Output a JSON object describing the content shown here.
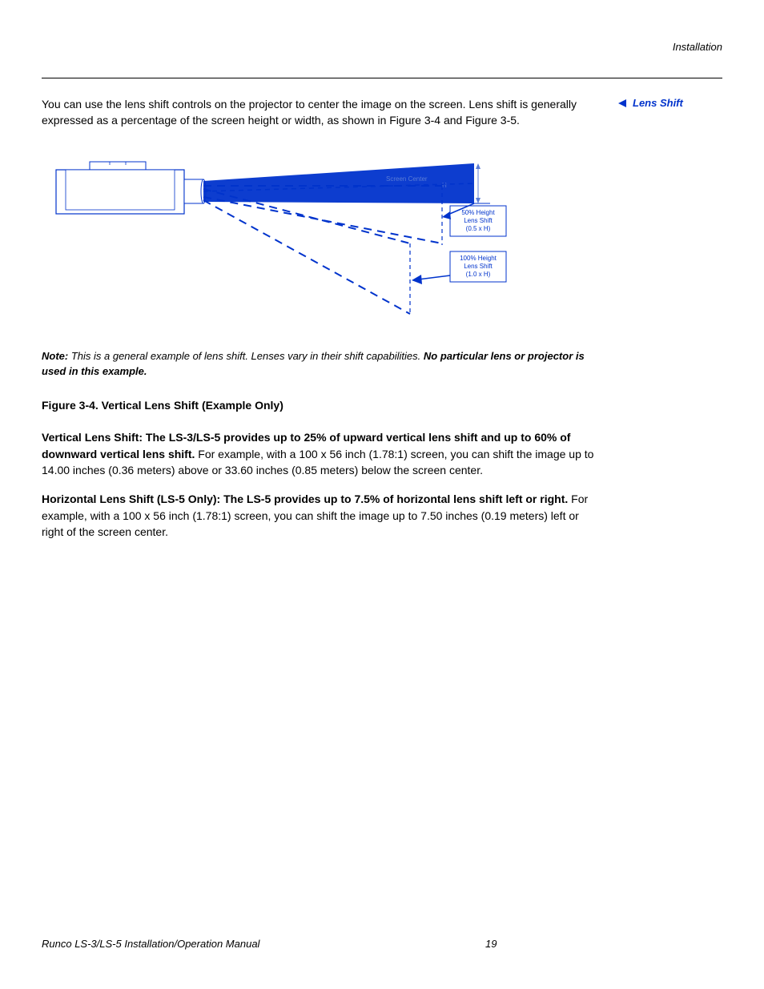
{
  "header": {
    "section": "Installation"
  },
  "sidebar": {
    "label": "Lens Shift"
  },
  "intro": "You can use the lens shift controls on the projector to center the image on the screen. Lens shift is generally expressed as a percentage of the screen height or width, as shown in Figure 3-4 and Figure 3-5.",
  "diagram": {
    "screen_center_label": "Screen Center",
    "h_label": "H",
    "box50_line1": "50% Height",
    "box50_line2": "Lens Shift",
    "box50_line3": "(0.5 x H)",
    "box100_line1": "100% Height",
    "box100_line2": "Lens Shift",
    "box100_line3": "(1.0 x H)"
  },
  "note": {
    "label": "Note:",
    "text": " This is a general example of lens shift. Lenses vary in their shift capabilities. ",
    "strong": "No particular lens or projector is used in this example."
  },
  "fig_caption": "Figure 3-4. Vertical Lens Shift (Example Only)",
  "para_vertical": {
    "strong": "Vertical Lens Shift: The LS-3/LS-5 provides up to 25% of upward vertical lens shift and up to 60% of downward vertical lens shift.",
    "rest": " For example, with a 100 x 56 inch (1.78:1) screen, you can shift the image up to 14.00 inches (0.36 meters) above or 33.60 inches (0.85 meters) below the screen center."
  },
  "para_horizontal": {
    "strong": "Horizontal Lens Shift (LS-5 Only): The LS-5 provides up to 7.5% of horizontal lens shift left or right.",
    "rest": " For example, with a 100 x 56 inch (1.78:1) screen, you can shift the image up to 7.50 inches (0.19 meters) left or right of the screen center."
  },
  "footer": {
    "title": "Runco LS-3/LS-5 Installation/Operation Manual",
    "page": "19"
  }
}
